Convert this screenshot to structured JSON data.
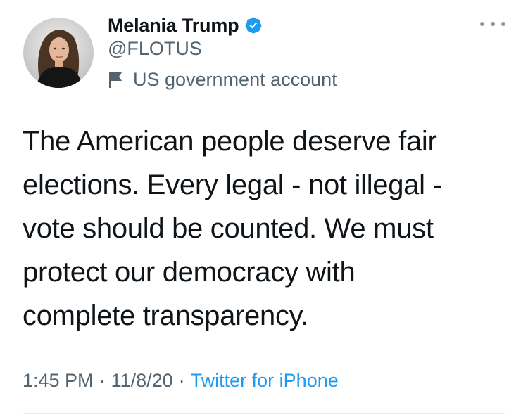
{
  "author": {
    "display_name": "Melania Trump",
    "handle": "@FLOTUS",
    "verified": true,
    "account_label": "US government account",
    "label_icon": "flag-icon"
  },
  "tweet": {
    "text": "The American people deserve fair\nelections. Every legal - not illegal -\nvote should be counted. We must\nprotect our democracy with\ncomplete transparency."
  },
  "meta": {
    "time": "1:45 PM",
    "separator": "·",
    "date": "11/8/20",
    "source": "Twitter for iPhone"
  },
  "icons": {
    "verified": "verified-badge-icon",
    "more": "more-options-icon"
  },
  "colors": {
    "text": "#0f1419",
    "secondary": "#536471",
    "link": "#1d9bf0",
    "verified": "#1d9bf0"
  }
}
